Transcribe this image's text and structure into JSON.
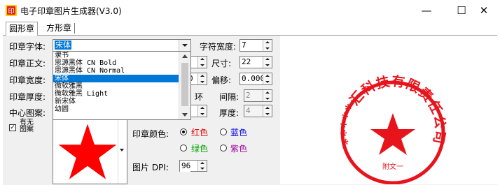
{
  "window": {
    "title": "电子印章图片生成器(V3.0)",
    "minimize_glyph": "—",
    "maximize_glyph": "☐",
    "close_glyph": "✕"
  },
  "tabs": [
    {
      "label": "圆形章",
      "active": true
    },
    {
      "label": "方形章",
      "active": false
    }
  ],
  "form": {
    "font_label": "印章字体:",
    "font_value": "宋体",
    "text_label": "印章正文:",
    "width_label": "印章宽度:",
    "thickness_label": "印章厚度:",
    "center_label": "中心图案:",
    "char_width_label": "字符宽度:",
    "char_width_value": "7",
    "size_label": "尺寸:",
    "size_value": "22",
    "offset_label": "偏移:",
    "offset_value": "0.000",
    "partial_value": "0",
    "ring_label": "环",
    "gap_label": "间隔:",
    "gap_value": "2",
    "thick_label": "厚度:",
    "thick_value": "4",
    "has_pattern_label": "有无图案",
    "has_pattern_checked": true,
    "color_label": "印章颜色:",
    "colors": [
      {
        "label": "红色",
        "color": "#e00000",
        "selected": true
      },
      {
        "label": "蓝色",
        "color": "#0000e0",
        "selected": false
      },
      {
        "label": "绿色",
        "color": "#00a000",
        "selected": false
      },
      {
        "label": "紫色",
        "color": "#a000a0",
        "selected": false
      }
    ],
    "dpi_label": "图片 DPI:",
    "dpi_value": "96"
  },
  "font_options": [
    {
      "label": "隶书",
      "selected": false
    },
    {
      "label": "思源黑体 CN Bold",
      "selected": false
    },
    {
      "label": "思源黑体 CN Normal",
      "selected": false
    },
    {
      "label": "宋体",
      "selected": true
    },
    {
      "label": "微软雅黑",
      "selected": false
    },
    {
      "label": "微软雅黑 Light",
      "selected": false
    },
    {
      "label": "新宋体",
      "selected": false
    },
    {
      "label": "幼圆",
      "selected": false
    }
  ],
  "preview": {
    "seal_text": "*****汇科技有限责任公司",
    "bottom_text": "附文一",
    "seal_color": "#e8141c"
  },
  "pattern_color": "#ff0000"
}
